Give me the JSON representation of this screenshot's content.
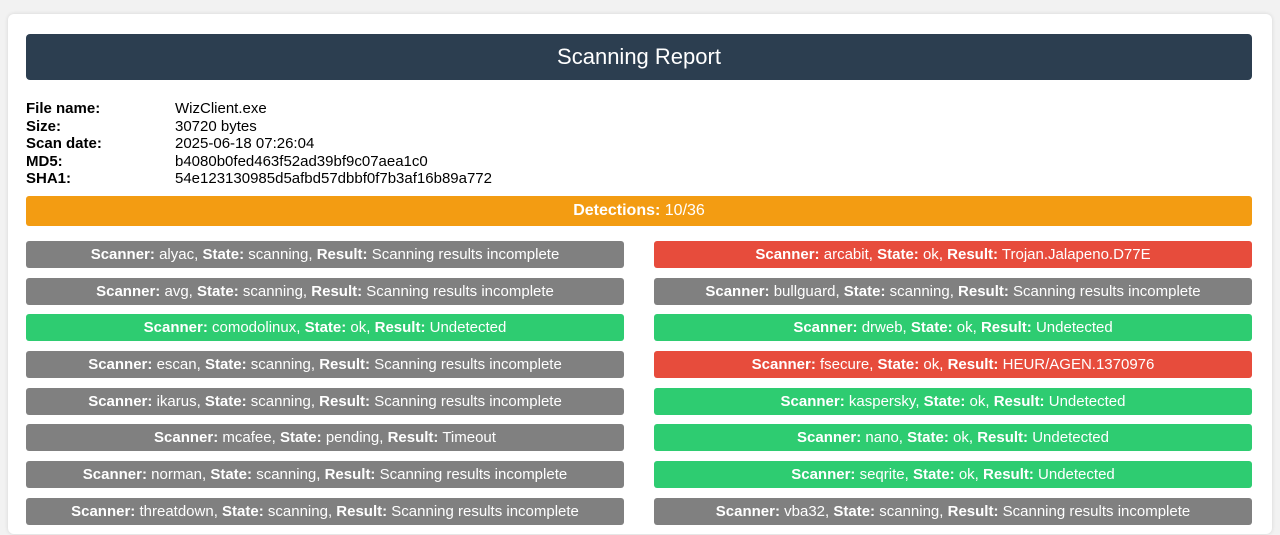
{
  "header": {
    "title": "Scanning Report"
  },
  "file": {
    "name_label": "File name:",
    "name": "WizClient.exe",
    "size_label": "Size:",
    "size": "30720 bytes",
    "date_label": "Scan date:",
    "date": "2025-06-18 07:26:04",
    "md5_label": "MD5:",
    "md5": "b4080b0fed463f52ad39bf9c07aea1c0",
    "sha1_label": "SHA1:",
    "sha1": "54e123130985d5afbd57dbbf0f7b3af16b89a772"
  },
  "detections": {
    "label": "Detections:",
    "value": "10/36"
  },
  "labels": {
    "scanner": "Scanner:",
    "state": "State:",
    "result": "Result:"
  },
  "colors": {
    "incomplete": "#808080",
    "clean": "#2ecc71",
    "detected": "#e74c3c",
    "header": "#2c3e50",
    "detections": "#f39c12"
  },
  "left_results": [
    {
      "scanner": "alyac",
      "state": "scanning",
      "result": "Scanning results incomplete",
      "status": "gray"
    },
    {
      "scanner": "avg",
      "state": "scanning",
      "result": "Scanning results incomplete",
      "status": "gray"
    },
    {
      "scanner": "comodolinux",
      "state": "ok",
      "result": "Undetected",
      "status": "green"
    },
    {
      "scanner": "escan",
      "state": "scanning",
      "result": "Scanning results incomplete",
      "status": "gray"
    },
    {
      "scanner": "ikarus",
      "state": "scanning",
      "result": "Scanning results incomplete",
      "status": "gray"
    },
    {
      "scanner": "mcafee",
      "state": "pending",
      "result": "Timeout",
      "status": "gray"
    },
    {
      "scanner": "norman",
      "state": "scanning",
      "result": "Scanning results incomplete",
      "status": "gray"
    },
    {
      "scanner": "threatdown",
      "state": "scanning",
      "result": "Scanning results incomplete",
      "status": "gray"
    }
  ],
  "right_results": [
    {
      "scanner": "arcabit",
      "state": "ok",
      "result": "Trojan.Jalapeno.D77E",
      "status": "red"
    },
    {
      "scanner": "bullguard",
      "state": "scanning",
      "result": "Scanning results incomplete",
      "status": "gray"
    },
    {
      "scanner": "drweb",
      "state": "ok",
      "result": "Undetected",
      "status": "green"
    },
    {
      "scanner": "fsecure",
      "state": "ok",
      "result": "HEUR/AGEN.1370976",
      "status": "red"
    },
    {
      "scanner": "kaspersky",
      "state": "ok",
      "result": "Undetected",
      "status": "green"
    },
    {
      "scanner": "nano",
      "state": "ok",
      "result": "Undetected",
      "status": "green"
    },
    {
      "scanner": "seqrite",
      "state": "ok",
      "result": "Undetected",
      "status": "green"
    },
    {
      "scanner": "vba32",
      "state": "scanning",
      "result": "Scanning results incomplete",
      "status": "gray"
    }
  ]
}
